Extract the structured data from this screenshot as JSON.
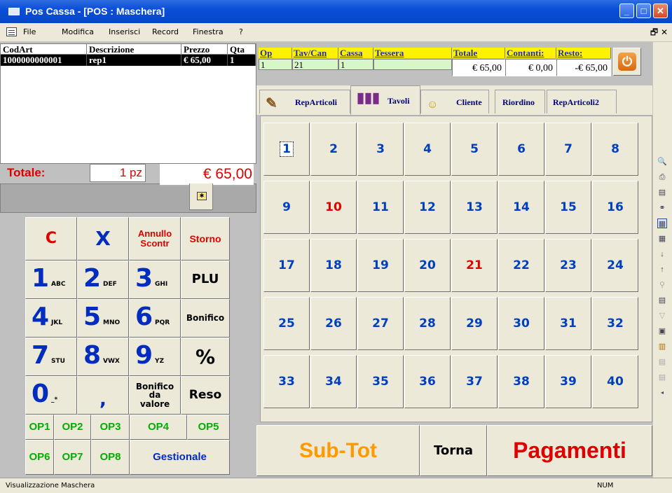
{
  "window": {
    "title": "Pos Cassa - [POS : Maschera]"
  },
  "menu": [
    "File",
    "Modifica",
    "Inserisci",
    "Record",
    "Finestra",
    "?"
  ],
  "grid": {
    "headers": [
      "CodArt",
      "Descrizione",
      "Prezzo",
      "Qta"
    ],
    "rows": [
      [
        "1000000000001",
        "rep1",
        "€ 65,00",
        "1"
      ]
    ]
  },
  "totals": {
    "label": "Totale:",
    "pieces": "1 pz",
    "amount": "€ 65,00"
  },
  "info": {
    "headers": [
      "Op",
      "Tav/Can",
      "Cassa",
      "Tessera",
      "Totale",
      "Contanti:",
      "Resto:"
    ],
    "values": {
      "op": "1",
      "tav": "21",
      "cassa": "1",
      "tessera": "",
      "totale": "€ 65,00",
      "contanti": "€ 0,00",
      "resto": "-€ 65,00"
    }
  },
  "tabs": [
    "RepArticoli",
    "Tavoli",
    "Cliente",
    "Riordino",
    "RepArticoli2"
  ],
  "active_tab": "Tavoli",
  "tables": [
    "1",
    "2",
    "3",
    "4",
    "5",
    "6",
    "7",
    "8",
    "9",
    "10",
    "11",
    "12",
    "13",
    "14",
    "15",
    "16",
    "17",
    "18",
    "19",
    "20",
    "21",
    "22",
    "23",
    "24",
    "25",
    "26",
    "27",
    "28",
    "29",
    "30",
    "31",
    "32",
    "33",
    "34",
    "35",
    "36",
    "37",
    "38",
    "39",
    "40"
  ],
  "busy_tables": [
    "10",
    "21"
  ],
  "keypad": {
    "c": "C",
    "x": "X",
    "annullo": "Annullo Scontr",
    "storno": "Storno",
    "k1": "1",
    "k1s": "ABC",
    "k2": "2",
    "k2s": "DEF",
    "k3": "3",
    "k3s": "GHI",
    "plu": "PLU",
    "k4": "4",
    "k4s": "JKL",
    "k5": "5",
    "k5s": "MNO",
    "k6": "6",
    "k6s": "PQR",
    "bonifico": "Bonifico",
    "k7": "7",
    "k7s": "STU",
    "k8": "8",
    "k8s": "VWX",
    "k9": "9",
    "k9s": "YZ",
    "perc": "%",
    "k0": "0",
    "k0s": "_*",
    "comma": ",",
    "bonval": "Bonifico da valore",
    "reso": "Reso",
    "op1": "OP1",
    "op2": "OP2",
    "op3": "OP3",
    "op4": "OP4",
    "op5": "OP5",
    "op6": "OP6",
    "op7": "OP7",
    "op8": "OP8",
    "gestionale": "Gestionale"
  },
  "bottom": {
    "subtot": "Sub-Tot",
    "torna": "Torna",
    "pagamenti": "Pagamenti"
  },
  "status": {
    "text": "Visualizzazione Maschera",
    "num": "NUM"
  },
  "colors": {
    "title_blue": "#0a4fd8",
    "info_yellow": "#fff200",
    "info_green": "#d8f7c8",
    "subtot_orange": "#ff9900",
    "pagamenti_red": "#e00000",
    "table_blue": "#0040c0",
    "op_green": "#00b000"
  }
}
